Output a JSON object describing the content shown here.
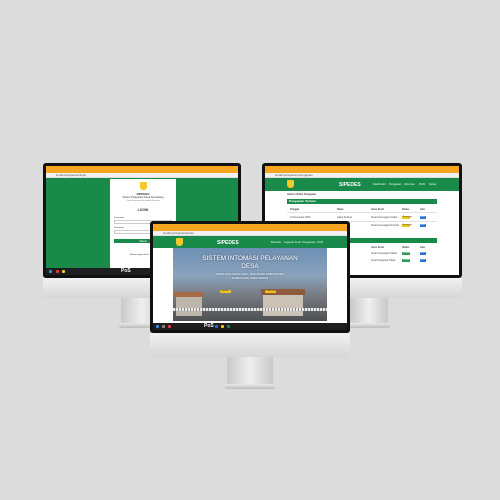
{
  "colors": {
    "background": "#dcdcdc",
    "brand_green": "#1a8a4a",
    "browser_orange": "#f6a623",
    "badge_yellow": "#f0c419",
    "button_blue": "#2d6cdf"
  },
  "left_screen": {
    "url": "localhost/sipedes/login",
    "login": {
      "app_name": "SIPEDES",
      "subtitle": "Sistem Pelayanan Desa Sumedang",
      "tagline": "Desa Sukamaju Kecamatan Sukasari",
      "heading": "LOGIN",
      "username_label": "Username",
      "password_label": "Password",
      "button_label": "Masuk",
      "footer": "Belum punya akun? Daftar"
    },
    "taskbar_logo": "PoS"
  },
  "right_screen": {
    "url": "localhost/sipedes/pengajuan",
    "brand": "SIPEDES",
    "nav": [
      "Dashboard",
      "Pengajuan",
      "Informasi",
      "Profil",
      "Keluar"
    ],
    "breadcrumb": "Admin / Daftar Pengajuan",
    "panel_title": "Pengajuan Terbaru",
    "table": {
      "headers": [
        "Tanggal",
        "Nama",
        "Jenis Surat",
        "Status",
        "Aksi"
      ],
      "rows": [
        [
          "12 Desember 2023",
          "Ujang Sutisna",
          "Surat Keterangan Usaha",
          "Menunggu",
          "Lihat"
        ],
        [
          "12 Desember 2023 12:34",
          "Siti Rohmah",
          "Surat Keterangan Domisili",
          "Menunggu",
          "Lihat"
        ]
      ]
    },
    "panel2_title": "Riwayat Pengajuan",
    "table2": {
      "headers": [
        "Jenis Surat",
        "Status",
        "Aksi"
      ],
      "rows": [
        [
          "Surat Keterangan Miskin",
          "Selesai",
          "Lihat"
        ],
        [
          "Surat Pengantar Nikah",
          "Selesai",
          "Lihat"
        ]
      ]
    }
  },
  "center_screen": {
    "url": "localhost/sipedes/index",
    "brand": "SIPEDES",
    "nav": [
      "Beranda",
      "Layanan Surat",
      "Pengaduan",
      "Profil"
    ],
    "hero": {
      "title_line1": "SISTEM INTOMASI PELAYANAN",
      "title_line2": "DESA",
      "subtitle_line1": "DESA SUKAMAJU KEC. SUKASARI KABUPATEN",
      "subtitle_line2": "SUMEDANG JAWA BARAT",
      "btn_left": "Layanan",
      "btn_right": "Pengaduan"
    },
    "taskbar_logo": "PoS"
  }
}
